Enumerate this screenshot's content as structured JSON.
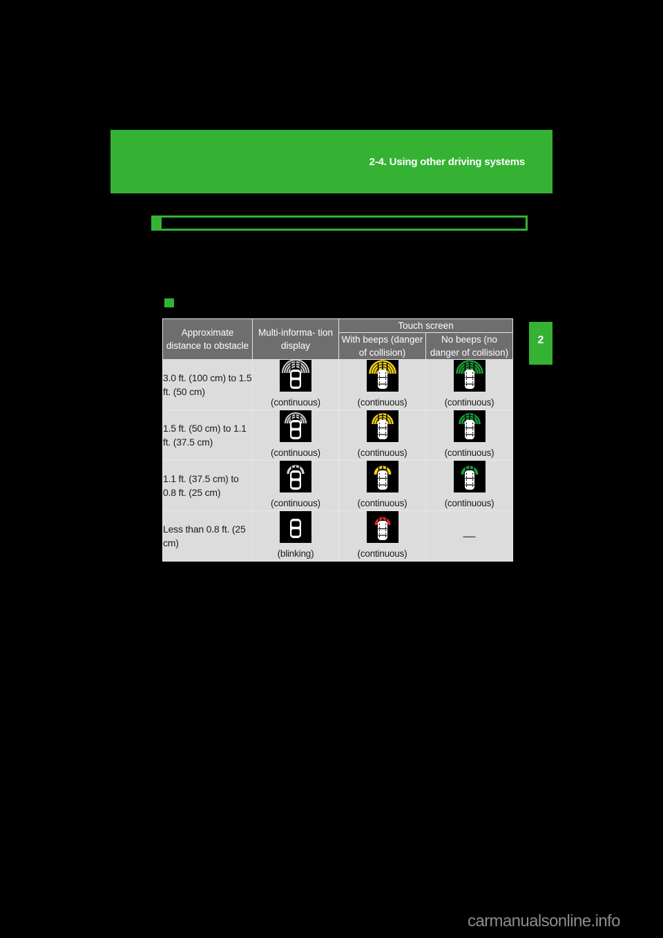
{
  "page": {
    "chapter_number": "2",
    "header_title": "2-4. Using other driving systems",
    "watermark": "carmanualsonline.info"
  },
  "table": {
    "headers": {
      "col1": "Approximate distance to obstacle",
      "col2": "Multi-informa- tion display",
      "group_touch_screen": "Touch screen",
      "col3": "With beeps (danger of collision)",
      "col4": "No beeps (no danger of collision)"
    },
    "rows": [
      {
        "distance": "3.0 ft. (100 cm) to 1.5 ft. (50 cm)",
        "mid": {
          "caption": "(continuous)",
          "icon": "car-sensor-arcs-gray-wide",
          "arc_color": "#cfcfcf",
          "arc_bands": 4,
          "arc_width": "wide"
        },
        "beeps": {
          "caption": "(continuous)",
          "icon": "car-sensor-arcs-yellow-wide",
          "arc_color": "#f2d218",
          "arc_bands": 4,
          "arc_width": "wide"
        },
        "nobeeps": {
          "caption": "(continuous)",
          "icon": "car-sensor-arcs-green-wide",
          "arc_color": "#1f9e3c",
          "arc_bands": 4,
          "arc_width": "wide"
        }
      },
      {
        "distance": "1.5 ft. (50 cm) to 1.1 ft. (37.5 cm)",
        "mid": {
          "caption": "(continuous)",
          "icon": "car-sensor-arcs-gray-mid",
          "arc_color": "#cfcfcf",
          "arc_bands": 3,
          "arc_width": "mid"
        },
        "beeps": {
          "caption": "(continuous)",
          "icon": "car-sensor-arcs-yellow-mid",
          "arc_color": "#f2d218",
          "arc_bands": 3,
          "arc_width": "mid"
        },
        "nobeeps": {
          "caption": "(continuous)",
          "icon": "car-sensor-arcs-green-mid",
          "arc_color": "#1f9e3c",
          "arc_bands": 3,
          "arc_width": "mid"
        }
      },
      {
        "distance": "1.1 ft. (37.5 cm) to 0.8 ft. (25 cm)",
        "mid": {
          "caption": "(continuous)",
          "icon": "car-sensor-arc-gray-narrow",
          "arc_color": "#cfcfcf",
          "arc_bands": 1,
          "arc_width": "narrow"
        },
        "beeps": {
          "caption": "(continuous)",
          "icon": "car-sensor-arc-yellow-narrow",
          "arc_color": "#f2d218",
          "arc_bands": 1,
          "arc_width": "narrow"
        },
        "nobeeps": {
          "caption": "(continuous)",
          "icon": "car-sensor-arc-green-narrow",
          "arc_color": "#1f9e3c",
          "arc_bands": 1,
          "arc_width": "narrow"
        }
      },
      {
        "distance": "Less than 0.8 ft. (25 cm)",
        "mid": {
          "caption": "(blinking)",
          "icon": "car-no-arcs",
          "arc_color": "none",
          "arc_bands": 0,
          "arc_width": "none"
        },
        "beeps": {
          "caption": "(continuous)",
          "icon": "car-sensor-arc-red-narrow",
          "arc_color": "#e0292b",
          "arc_bands": 1,
          "arc_width": "narrow"
        },
        "nobeeps": {
          "caption": "—",
          "icon": "dash",
          "arc_color": "none",
          "arc_bands": 0,
          "arc_width": "none"
        }
      }
    ]
  },
  "colors": {
    "brand_green": "#35B233",
    "header_gray": "#6e6e6e",
    "row_gray": "#dcdcdc",
    "icon_bg": "#000000",
    "warn_yellow": "#f2d218",
    "safe_green": "#1f9e3c",
    "alert_red": "#e0292b"
  }
}
